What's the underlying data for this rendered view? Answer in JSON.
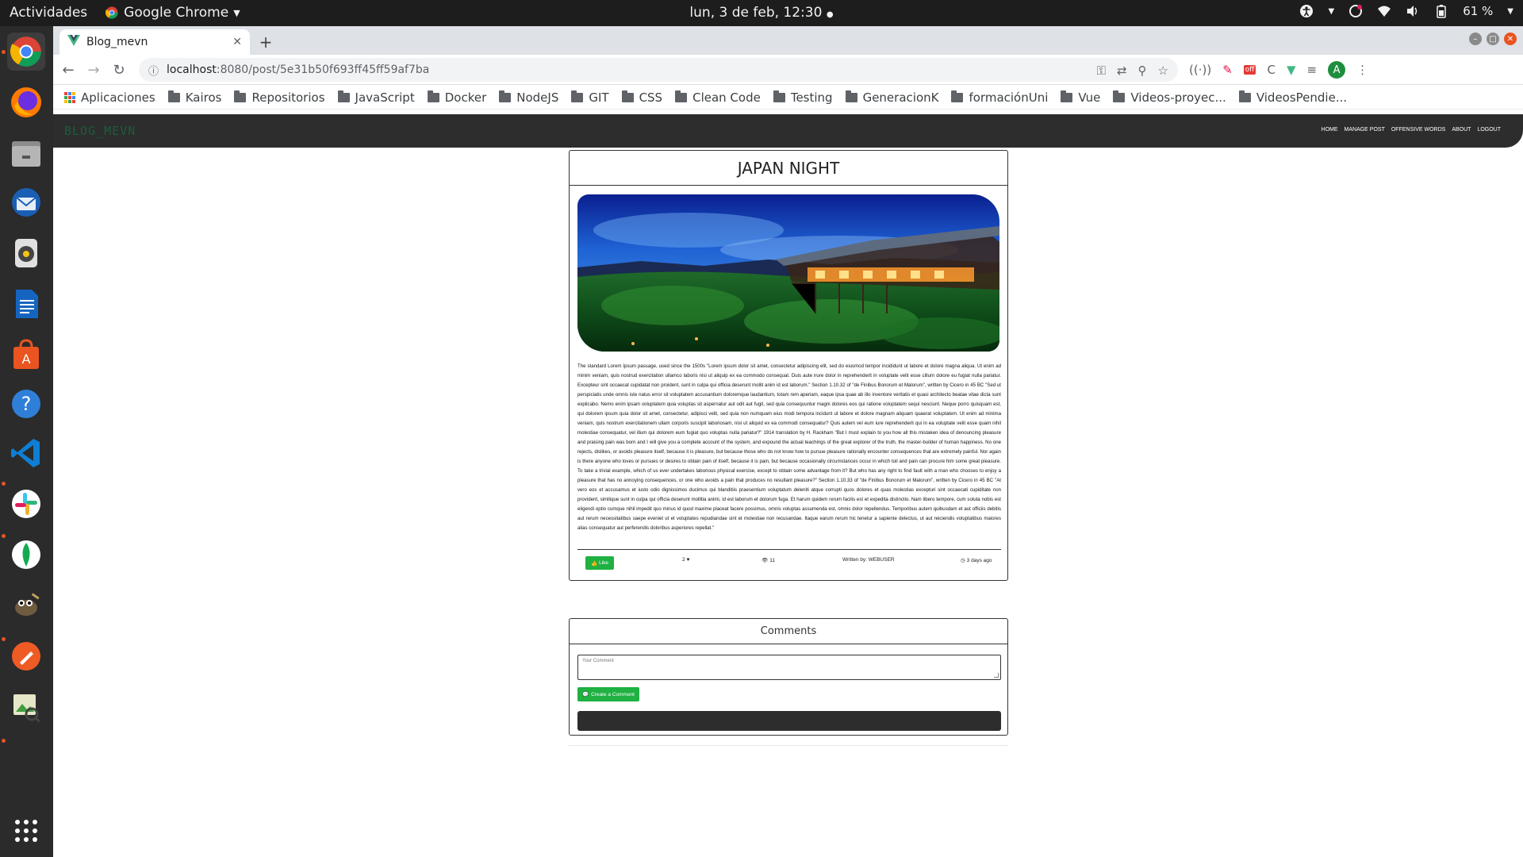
{
  "desktop": {
    "activities": "Actividades",
    "app_name": "Google Chrome",
    "clock": "lun, 3 de feb, 12:30",
    "battery": "61 %"
  },
  "browser": {
    "tab_title": "Blog_mevn",
    "url_host": "localhost",
    "url_path": ":8080/post/5e31b50f693ff45ff59af7ba",
    "avatar_letter": "A",
    "bookmarks": [
      "Aplicaciones",
      "Kairos",
      "Repositorios",
      "JavaScript",
      "Docker",
      "NodeJS",
      "GIT",
      "CSS",
      "Clean Code",
      "Testing",
      "GeneracionK",
      "formaciónUni",
      "Vue",
      "Videos-proyec...",
      "VideosPendie..."
    ]
  },
  "app": {
    "brand": "BLOG_MEVN",
    "nav": [
      "HOME",
      "MANAGE POST",
      "OFFENSIVE WORDS",
      "ABOUT",
      "LOGOUT"
    ]
  },
  "post": {
    "title": "JAPAN NIGHT",
    "body": "The standard Lorem Ipsum passage, used since the 1500s \"Lorem ipsum dolor sit amet, consectetur adipiscing elit, sed do eiusmod tempor incididunt ut labore et dolore magna aliqua. Ut enim ad minim veniam, quis nostrud exercitation ullamco laboris nisi ut aliquip ex ea commodo consequat. Duis aute irure dolor in reprehenderit in voluptate velit esse cillum dolore eu fugiat nulla pariatur. Excepteur sint occaecat cupidatat non proident, sunt in culpa qui officia deserunt mollit anim id est laborum.\" Section 1.10.32 of \"de Finibus Bonorum et Malorum\", written by Cicero in 45 BC \"Sed ut perspiciatis unde omnis iste natus error sit voluptatem accusantium doloremque laudantium, totam rem aperiam, eaque ipsa quae ab illo inventore veritatis et quasi architecto beatae vitae dicta sunt explicabo. Nemo enim ipsam voluptatem quia voluptas sit aspernatur aut odit aut fugit, sed quia consequuntur magni dolores eos qui ratione voluptatem sequi nesciunt. Neque porro quisquam est, qui dolorem ipsum quia dolor sit amet, consectetur, adipisci velit, sed quia non numquam eius modi tempora incidunt ut labore et dolore magnam aliquam quaerat voluptatem. Ut enim ad minima veniam, quis nostrum exercitationem ullam corporis suscipit laboriosam, nisi ut aliquid ex ea commodi consequatur? Quis autem vel eum iure reprehenderit qui in ea voluptate velit esse quam nihil molestiae consequatur, vel illum qui dolorem eum fugiat quo voluptas nulla pariatur?\" 1914 translation by H. Rackham \"But I must explain to you how all this mistaken idea of denouncing pleasure and praising pain was born and I will give you a complete account of the system, and expound the actual teachings of the great explorer of the truth, the master-builder of human happiness. No one rejects, dislikes, or avoids pleasure itself, because it is pleasure, but because those who do not know how to pursue pleasure rationally encounter consequences that are extremely painful. Nor again is there anyone who loves or pursues or desires to obtain pain of itself, because it is pain, but because occasionally circumstances occur in which toil and pain can procure him some great pleasure. To take a trivial example, which of us ever undertakes laborious physical exercise, except to obtain some advantage from it? But who has any right to find fault with a man who chooses to enjoy a pleasure that has no annoying consequences, or one who avoids a pain that produces no resultant pleasure?\" Section 1.10.33 of \"de Finibus Bonorum et Malorum\", written by Cicero in 45 BC \"At vero eos et accusamus et iusto odio dignissimos ducimus qui blanditiis praesentium voluptatum deleniti atque corrupti quos dolores et quas molestias excepturi sint occaecati cupiditate non provident, similique sunt in culpa qui officia deserunt mollitia animi, id est laborum et dolorum fuga. Et harum quidem rerum facilis est et expedita distinctio. Nam libero tempore, cum soluta nobis est eligendi optio cumque nihil impedit quo minus id quod maxime placeat facere possimus, omnis voluptas assumenda est, omnis dolor repellendus. Temporibus autem quibusdam et aut officiis debitis aut rerum necessitatibus saepe eveniet ut et voluptates repudiandae sint et molestiae non recusandae. Itaque earum rerum hic tenetur a sapiente delectus, ut aut reiciendis voluptatibus maiores alias consequatur aut perferendis doloribus asperiores repellat.\"",
    "like_label": "Like",
    "likes_count": "2",
    "views_count": "11",
    "author": "Written by: WEBUSER",
    "time_ago": "3 days ago"
  },
  "comments": {
    "header": "Comments",
    "placeholder": "Your Comment",
    "create_label": "Create a Comment"
  },
  "colors": {
    "accent_green": "#1fb141",
    "nav_dark": "#2d2d2d",
    "ubuntu_orange": "#e95420"
  }
}
